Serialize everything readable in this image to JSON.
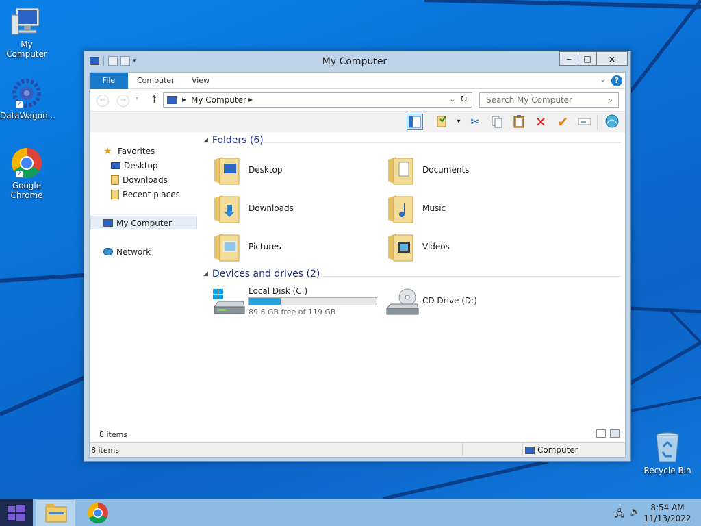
{
  "desktop": {
    "icons": [
      {
        "label": "My Computer"
      },
      {
        "label": "DataWagon..."
      },
      {
        "label": "Google Chrome"
      },
      {
        "label": "Recycle Bin"
      }
    ]
  },
  "window": {
    "title": "My Computer",
    "controls": {
      "minimize": "‒",
      "maximize": "□",
      "close": "x"
    },
    "tabs": {
      "file": "File",
      "computer": "Computer",
      "view": "View"
    },
    "help": "?",
    "address": {
      "crumb": "My Computer"
    },
    "search": {
      "placeholder": "Search My Computer"
    },
    "navpane": {
      "favorites": "Favorites",
      "desktop": "Desktop",
      "downloads": "Downloads",
      "recent": "Recent places",
      "mycomputer": "My Computer",
      "network": "Network"
    },
    "folders_group": "Folders (6)",
    "folders": [
      "Desktop",
      "Documents",
      "Downloads",
      "Music",
      "Pictures",
      "Videos"
    ],
    "drives_group": "Devices and drives (2)",
    "drives": {
      "c_name": "Local Disk (C:)",
      "c_free": "89.6 GB free of 119 GB",
      "c_used_fraction": 0.247,
      "d_name": "CD Drive (D:)"
    },
    "items_count": "8 items",
    "status_count": "8 items",
    "status_location": "Computer"
  },
  "taskbar": {
    "time": "8:54 AM",
    "date": "11/13/2022"
  },
  "colors": {
    "accent": "#1979ca",
    "progress": "#26a0da",
    "group_header": "#1e3287"
  }
}
